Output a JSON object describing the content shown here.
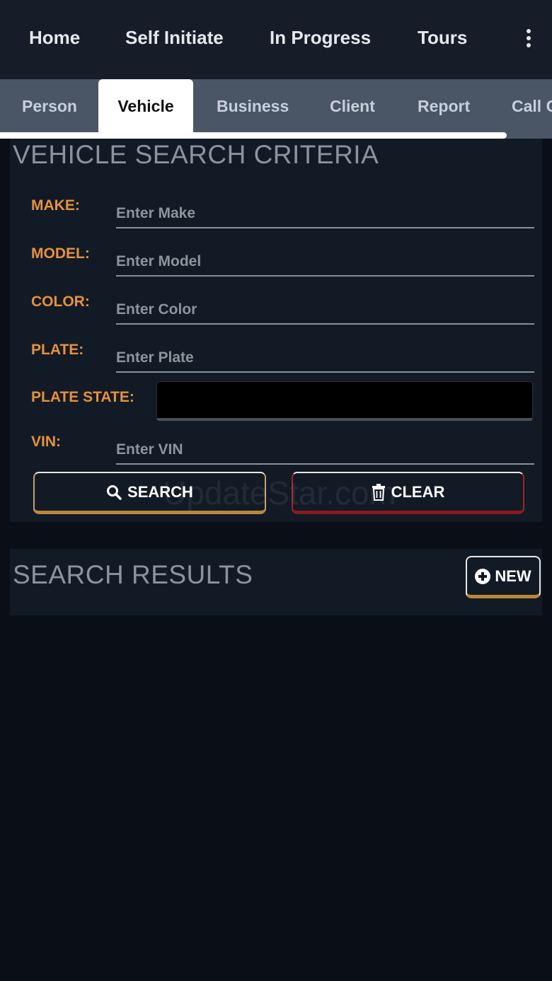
{
  "top_nav": {
    "items": [
      "Home",
      "Self Initiate",
      "In Progress",
      "Tours"
    ],
    "menu_icon": "kebab-menu-icon"
  },
  "tabs": {
    "items": [
      "Person",
      "Vehicle",
      "Business",
      "Client",
      "Report",
      "Call C"
    ],
    "active": "Vehicle"
  },
  "criteria": {
    "title": "VEHICLE SEARCH CRITERIA",
    "fields": {
      "make": {
        "label": "MAKE:",
        "placeholder": "Enter Make",
        "value": ""
      },
      "model": {
        "label": "MODEL:",
        "placeholder": "Enter Model",
        "value": ""
      },
      "color": {
        "label": "COLOR:",
        "placeholder": "Enter Color",
        "value": ""
      },
      "plate": {
        "label": "PLATE:",
        "placeholder": "Enter Plate",
        "value": ""
      },
      "plate_state": {
        "label": "PLATE STATE:",
        "value": ""
      },
      "vin": {
        "label": "VIN:",
        "placeholder": "Enter VIN",
        "value": ""
      }
    },
    "search_label": "SEARCH",
    "clear_label": "CLEAR"
  },
  "results": {
    "title": "SEARCH RESULTS",
    "new_label": "NEW"
  },
  "watermark": "UpdateStar.com",
  "colors": {
    "background": "#0a0f17",
    "panel": "#121a26",
    "label_orange": "#e8913a",
    "search_accent": "#b8893a",
    "clear_accent": "#a32424"
  }
}
